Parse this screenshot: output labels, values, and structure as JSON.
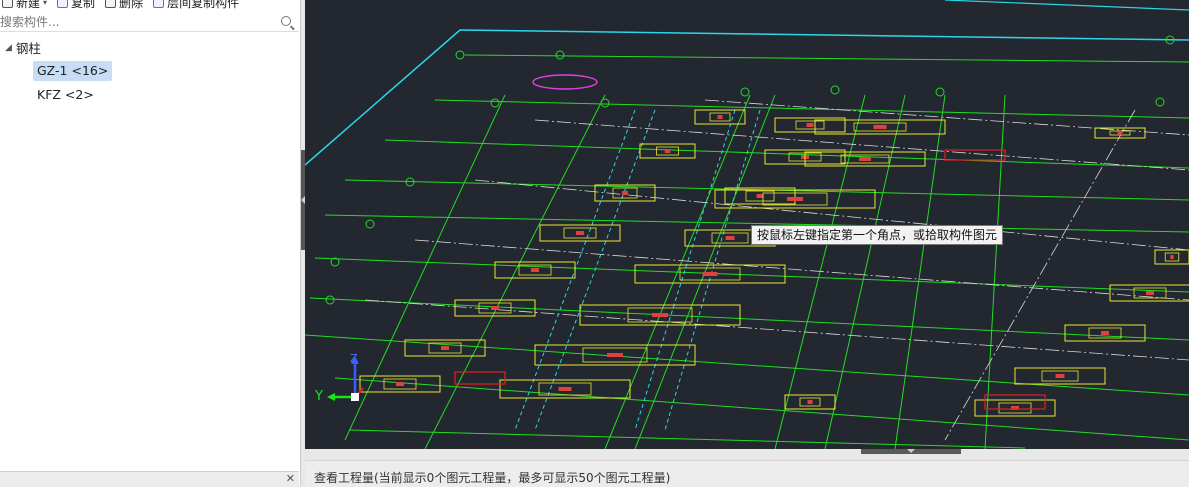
{
  "toolbar": {
    "new_label": "新建",
    "copy_label": "复制",
    "delete_label": "删除",
    "floor_copy_label": "层间复制构件"
  },
  "search": {
    "placeholder": "搜索构件..."
  },
  "tree": {
    "group_label": "钢柱",
    "items": [
      {
        "label": "GZ-1 <16>",
        "selected": true
      },
      {
        "label": "KFZ <2>",
        "selected": false
      }
    ]
  },
  "canvas": {
    "tooltip": "按鼠标左键指定第一个角点，或拾取构件图元",
    "axis_y_label": "Y",
    "axis_z_label": "Z"
  },
  "status": {
    "text": "查看工程量(当前显示0个图元工程量，最多可显示50个图元工程量)"
  },
  "colors": {
    "canvas_bg": "#222730",
    "grid_green": "#22dd22",
    "outline_cyan": "#28d8e8",
    "footing_yellow": "#e8e830",
    "selection_bg": "#c7dcf5"
  },
  "icons": [
    "new-icon",
    "copy-icon",
    "delete-icon",
    "floor-copy-icon",
    "search-icon",
    "close-icon",
    "axis-gizmo-icon"
  ]
}
